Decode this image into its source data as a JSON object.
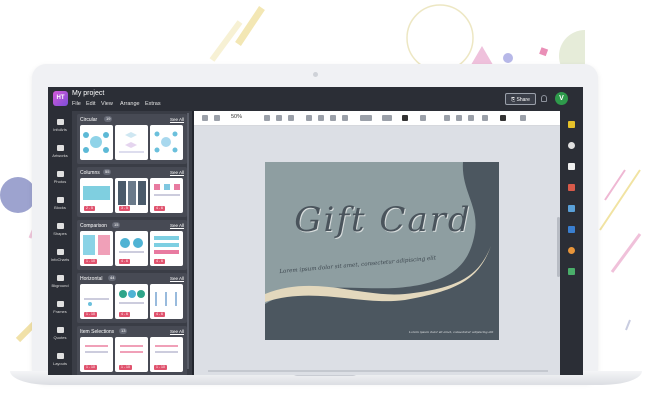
{
  "app": {
    "project_title": "My project",
    "menu": [
      "File",
      "Edit",
      "View",
      "Arrange",
      "Extras"
    ],
    "share_label": "Share",
    "avatar_initial": "V",
    "logo_text": "HT"
  },
  "rail": [
    {
      "label": "InfoArts",
      "icon": "infoarts-icon"
    },
    {
      "label": "Artworks",
      "icon": "artworks-icon"
    },
    {
      "label": "Photos",
      "icon": "photos-icon"
    },
    {
      "label": "Blocks",
      "icon": "blocks-icon"
    },
    {
      "label": "Shapes",
      "icon": "shapes-icon"
    },
    {
      "label": "InfoCharts",
      "icon": "infocharts-icon"
    },
    {
      "label": "Bkground",
      "icon": "background-icon"
    },
    {
      "label": "Frames",
      "icon": "frames-icon"
    },
    {
      "label": "Quotes",
      "icon": "quotes-icon"
    },
    {
      "label": "Layouts",
      "icon": "layouts-icon"
    }
  ],
  "sections": [
    {
      "title": "Circular",
      "count": "19",
      "see_all": "See All",
      "badges": []
    },
    {
      "title": "Columns",
      "count": "55",
      "see_all": "See All",
      "badges": [
        "2 - 5",
        "3 - 5",
        "4 - 6"
      ]
    },
    {
      "title": "Comparison",
      "count": "15",
      "see_all": "See All",
      "badges": [
        "1 - 10",
        "4 - 6",
        "4 - 6"
      ]
    },
    {
      "title": "Horizontal",
      "count": "44",
      "see_all": "See All",
      "badges": [
        "1 - 10",
        "4 - 6",
        "4 - 6"
      ]
    },
    {
      "title": "Item Selections",
      "count": "13",
      "see_all": "See All",
      "badges": [
        "1 - 10",
        "1 - 10",
        "1 - 10"
      ]
    }
  ],
  "toolbar": {
    "zoom": "50%"
  },
  "card": {
    "title": "Gift Card",
    "subtitle": "Lorem ipsum dolor sit amet, consectetur adipiscing elit",
    "footer": "Lorem ipsum dolor sit amet, consectetur adipiscing elit"
  },
  "colors": {
    "card_bg": "#8e9ea1",
    "card_dark": "#4c5760",
    "card_wave": "#e3d8bd",
    "accent_pink": "#e0536e"
  }
}
